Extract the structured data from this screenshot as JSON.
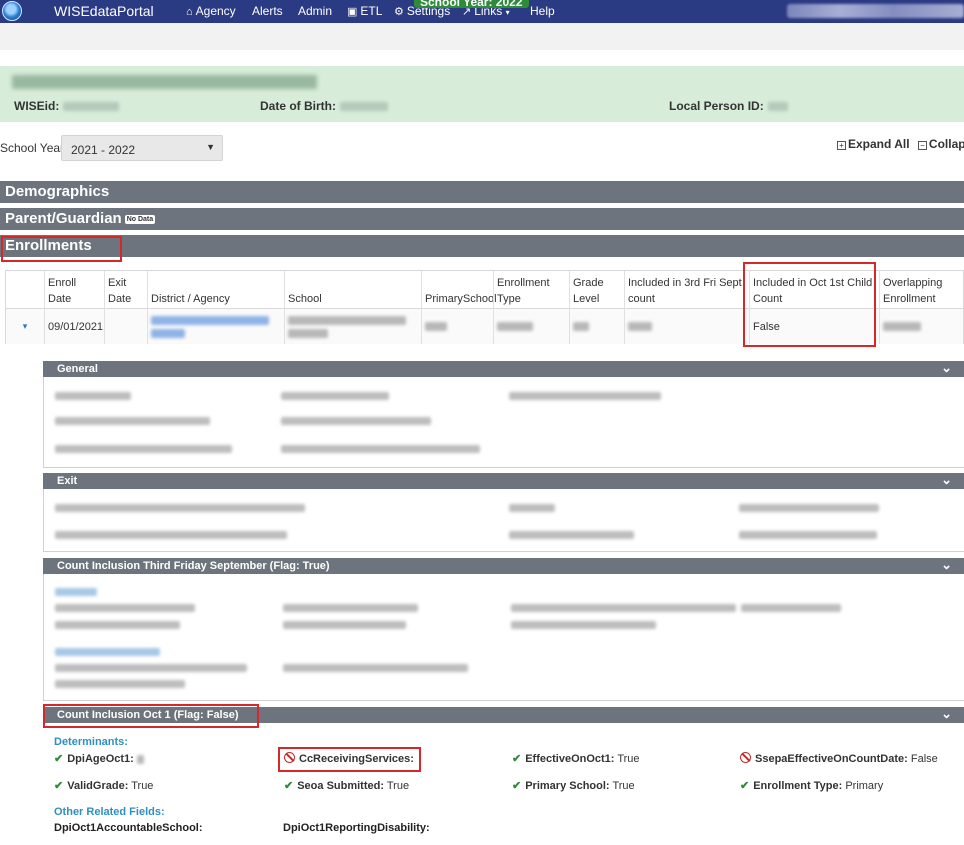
{
  "nav": {
    "brand": "WISEdataPortal",
    "items": [
      {
        "label": "Agency",
        "icon": "home-icon"
      },
      {
        "label": "Alerts"
      },
      {
        "label": "Admin"
      },
      {
        "label": "ETL",
        "icon": "database-icon"
      },
      {
        "label": "Settings",
        "icon": "gear-icon"
      },
      {
        "label": "Links",
        "icon": "external-link-icon"
      },
      {
        "label": "Help"
      }
    ],
    "school_year_badge": "School Year: 2022"
  },
  "student": {
    "wiseid_label": "WISEid:",
    "dob_label": "Date of Birth:",
    "local_id_label": "Local Person ID:"
  },
  "filters": {
    "school_year_label": "School Year",
    "school_year_value": "2021 - 2022",
    "expand_all": "Expand All",
    "collapse": "Collapse"
  },
  "sections": {
    "demographics": "Demographics",
    "parent_guardian": "Parent/Guardian",
    "no_data": "No Data",
    "enrollments": "Enrollments"
  },
  "enrollment_table": {
    "headers": [
      "Enroll Date",
      "Exit Date",
      "District / Agency",
      "School",
      "PrimarySchool",
      "Enrollment Type",
      "Grade Level",
      "Included in 3rd Fri Sept count",
      "Included in Oct 1st Child Count",
      "Overlapping Enrollment"
    ],
    "row": {
      "enroll_date": "09/01/2021",
      "included_oct1": "False"
    }
  },
  "panels": {
    "general": "General",
    "exit": "Exit",
    "third_friday": "Count Inclusion Third Friday September (Flag: True)",
    "oct1": "Count Inclusion Oct 1 (Flag: False)"
  },
  "oct1": {
    "determinants_label": "Determinants:",
    "determinants": [
      {
        "label": "DpiAgeOct1:",
        "value": "",
        "status": "pass"
      },
      {
        "label": "CcReceivingServices:",
        "value": "",
        "status": "fail"
      },
      {
        "label": "EffectiveOnOct1:",
        "value": "True",
        "status": "pass"
      },
      {
        "label": "SsepaEffectiveOnCountDate:",
        "value": "False",
        "status": "fail"
      },
      {
        "label": "ValidGrade:",
        "value": "True",
        "status": "pass"
      },
      {
        "label": "Seoa Submitted:",
        "value": "True",
        "status": "pass"
      },
      {
        "label": "Primary School:",
        "value": "True",
        "status": "pass"
      },
      {
        "label": "Enrollment Type:",
        "value": "Primary",
        "status": "pass"
      }
    ],
    "other_label": "Other Related Fields:",
    "other_fields": [
      "DpiOct1AccountableSchool:",
      "DpiOct1ReportingDisability:"
    ]
  },
  "colors": {
    "nav": "#2a3a83",
    "section": "#6d747d",
    "student_header": "#d7ecd9",
    "highlight": "#d62828",
    "check": "#2f8a3a"
  }
}
